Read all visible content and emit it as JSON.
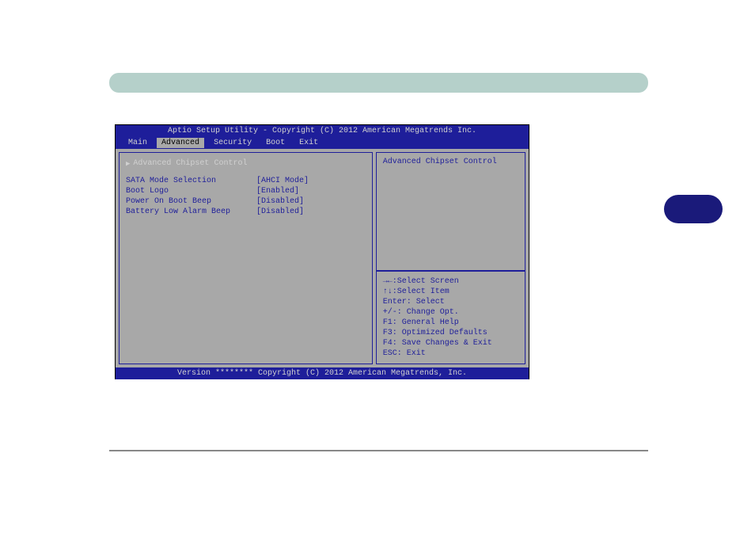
{
  "bios": {
    "title": "Aptio Setup Utility - Copyright (C) 2012 American Megatrends Inc.",
    "footer": "Version ******** Copyright (C) 2012 American Megatrends, Inc.",
    "menu": {
      "main": "Main",
      "advanced": "Advanced",
      "security": "Security",
      "boot": "Boot",
      "exit": "Exit"
    },
    "submenu": {
      "advanced_chipset": "Advanced Chipset Control"
    },
    "settings": {
      "sata_mode": {
        "label": "SATA Mode Selection",
        "value": "[AHCI Mode]"
      },
      "boot_logo": {
        "label": "Boot Logo",
        "value": "[Enabled]"
      },
      "power_boot_beep": {
        "label": "Power On Boot Beep",
        "value": "[Disabled]"
      },
      "battery_low_beep": {
        "label": "Battery Low Alarm Beep",
        "value": "[Disabled]"
      }
    },
    "side_panel": {
      "description": "Advanced Chipset Control"
    },
    "help": {
      "line1": "→←:Select Screen",
      "line2": "↑↓:Select Item",
      "line3": "Enter: Select",
      "line4": "+/-: Change Opt.",
      "line5": "F1: General Help",
      "line6": "F3: Optimized Defaults",
      "line7": "F4: Save Changes & Exit",
      "line8": "ESC: Exit"
    }
  }
}
